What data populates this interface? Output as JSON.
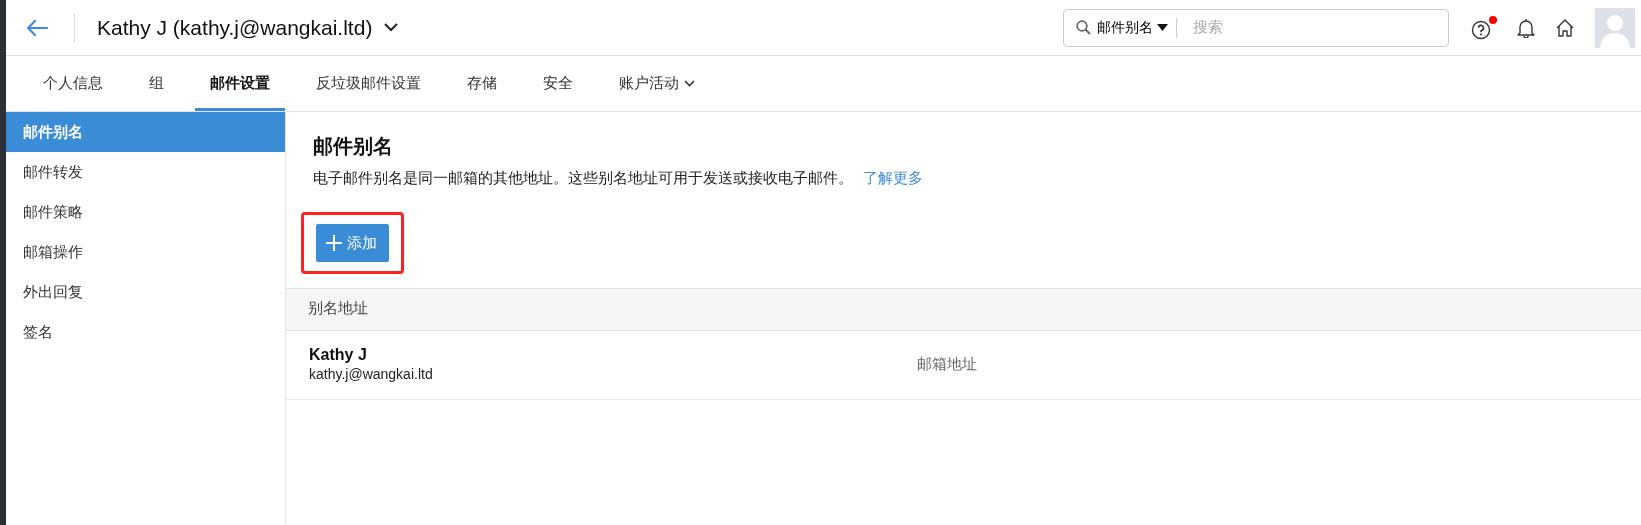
{
  "header": {
    "title": "Kathy J (kathy.j@wangkai.ltd)",
    "search": {
      "scope": "邮件别名",
      "placeholder": "搜索"
    },
    "help_notification": true
  },
  "tabs": [
    {
      "label": "个人信息",
      "selected": false,
      "dropdown": false
    },
    {
      "label": "组",
      "selected": false,
      "dropdown": false
    },
    {
      "label": "邮件设置",
      "selected": true,
      "dropdown": false
    },
    {
      "label": "反垃圾邮件设置",
      "selected": false,
      "dropdown": false
    },
    {
      "label": "存储",
      "selected": false,
      "dropdown": false
    },
    {
      "label": "安全",
      "selected": false,
      "dropdown": false
    },
    {
      "label": "账户活动",
      "selected": false,
      "dropdown": true
    }
  ],
  "sidebar": {
    "items": [
      {
        "label": "邮件别名",
        "selected": true
      },
      {
        "label": "邮件转发",
        "selected": false
      },
      {
        "label": "邮件策略",
        "selected": false
      },
      {
        "label": "邮箱操作",
        "selected": false
      },
      {
        "label": "外出回复",
        "selected": false
      },
      {
        "label": "签名",
        "selected": false
      }
    ]
  },
  "content": {
    "title": "邮件别名",
    "description": "电子邮件别名是同一邮箱的其他地址。这些别名地址可用于发送或接收电子邮件。",
    "link": "了解更多",
    "add_button": {
      "label": "添加",
      "highlighted": true
    },
    "table": {
      "columns": [
        "别名地址"
      ],
      "rows": [
        {
          "name": "Kathy J",
          "email": "kathy.j@wangkai.ltd",
          "type": "邮箱地址"
        }
      ]
    }
  }
}
